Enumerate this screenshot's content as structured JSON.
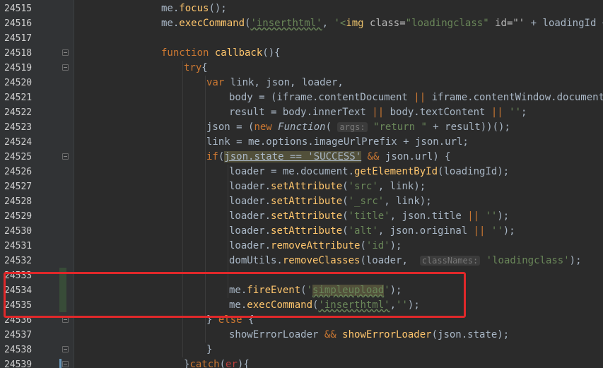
{
  "editor": {
    "lines": [
      {
        "n": "24515",
        "segs": [
          [
            "me.",
            "t"
          ],
          [
            "focus",
            "meth"
          ],
          [
            "();",
            "t"
          ]
        ],
        "indent": 228
      },
      {
        "n": "24516",
        "segs": [
          [
            "me.",
            "t"
          ],
          [
            "execCommand",
            "meth"
          ],
          [
            "(",
            "t"
          ],
          [
            "'inserthtml'",
            "str-sq"
          ],
          [
            ", ",
            "t"
          ],
          [
            "'<",
            "str"
          ],
          [
            "img",
            "tag"
          ],
          [
            " class=",
            "attr"
          ],
          [
            "\"loadingclass\"",
            "str"
          ],
          [
            " id=\"'",
            "attr"
          ],
          [
            " + loadingId + ",
            "t"
          ],
          [
            "'\"",
            "str"
          ]
        ],
        "indent": 228
      },
      {
        "n": "24517",
        "segs": [],
        "indent": 228
      },
      {
        "n": "24518",
        "segs": [
          [
            "function ",
            "kw"
          ],
          [
            "callback",
            "fn"
          ],
          [
            "(){",
            "t"
          ]
        ],
        "indent": 228
      },
      {
        "n": "24519",
        "segs": [
          [
            "try",
            "kw"
          ],
          [
            "{",
            "t"
          ]
        ],
        "indent": 260
      },
      {
        "n": "24520",
        "segs": [
          [
            "var ",
            "kw"
          ],
          [
            "link, json, loader,",
            "t"
          ]
        ],
        "indent": 292
      },
      {
        "n": "24521",
        "segs": [
          [
            "body = (iframe.contentDocument ",
            "t"
          ],
          [
            "||",
            "kw"
          ],
          [
            " iframe.contentWindow.document).b",
            "t"
          ]
        ],
        "indent": 324
      },
      {
        "n": "24522",
        "segs": [
          [
            "result = body.innerText ",
            "t"
          ],
          [
            "||",
            "kw"
          ],
          [
            " body.textContent ",
            "t"
          ],
          [
            "||",
            "kw"
          ],
          [
            " ",
            "t"
          ],
          [
            "''",
            "str"
          ],
          [
            ";",
            "t"
          ]
        ],
        "indent": 324
      },
      {
        "n": "24523",
        "segs": [
          [
            "json = (",
            "t"
          ],
          [
            "new ",
            "kw"
          ],
          [
            "Function",
            "it"
          ],
          [
            "( ",
            "t"
          ],
          [
            "args:",
            "hint"
          ],
          [
            " ",
            "t"
          ],
          [
            "\"return \"",
            "str"
          ],
          [
            " + result))();",
            "t"
          ]
        ],
        "indent": 292
      },
      {
        "n": "24524",
        "segs": [
          [
            "link = me.options.imageUrlPrefix + json.url;",
            "t"
          ]
        ],
        "indent": 292
      },
      {
        "n": "24525",
        "segs": [
          [
            "if",
            "kw"
          ],
          [
            "(",
            "t"
          ],
          [
            "json.state == 'SUCCESS'",
            "hlcond"
          ],
          [
            " ",
            "t"
          ],
          [
            "&&",
            "kw"
          ],
          [
            " json.url) {",
            "t"
          ]
        ],
        "indent": 292
      },
      {
        "n": "24526",
        "segs": [
          [
            "loader = me.document.",
            "t"
          ],
          [
            "getElementById",
            "meth"
          ],
          [
            "(loadingId);",
            "t"
          ]
        ],
        "indent": 324
      },
      {
        "n": "24527",
        "segs": [
          [
            "loader.",
            "t"
          ],
          [
            "setAttribute",
            "meth"
          ],
          [
            "(",
            "t"
          ],
          [
            "'src'",
            "str"
          ],
          [
            ", link);",
            "t"
          ]
        ],
        "indent": 324
      },
      {
        "n": "24528",
        "segs": [
          [
            "loader.",
            "t"
          ],
          [
            "setAttribute",
            "meth"
          ],
          [
            "(",
            "t"
          ],
          [
            "'_src'",
            "str"
          ],
          [
            ", link);",
            "t"
          ]
        ],
        "indent": 324
      },
      {
        "n": "24529",
        "segs": [
          [
            "loader.",
            "t"
          ],
          [
            "setAttribute",
            "meth"
          ],
          [
            "(",
            "t"
          ],
          [
            "'title'",
            "str"
          ],
          [
            ", json.title ",
            "t"
          ],
          [
            "||",
            "kw"
          ],
          [
            " ",
            "t"
          ],
          [
            "''",
            "str"
          ],
          [
            ");",
            "t"
          ]
        ],
        "indent": 324
      },
      {
        "n": "24530",
        "segs": [
          [
            "loader.",
            "t"
          ],
          [
            "setAttribute",
            "meth"
          ],
          [
            "(",
            "t"
          ],
          [
            "'alt'",
            "str"
          ],
          [
            ", json.original ",
            "t"
          ],
          [
            "||",
            "kw"
          ],
          [
            " ",
            "t"
          ],
          [
            "''",
            "str"
          ],
          [
            ");",
            "t"
          ]
        ],
        "indent": 324
      },
      {
        "n": "24531",
        "segs": [
          [
            "loader.",
            "t"
          ],
          [
            "removeAttribute",
            "meth"
          ],
          [
            "(",
            "t"
          ],
          [
            "'id'",
            "str"
          ],
          [
            ");",
            "t"
          ]
        ],
        "indent": 324
      },
      {
        "n": "24532",
        "segs": [
          [
            "domUtils.",
            "t"
          ],
          [
            "removeClasses",
            "meth"
          ],
          [
            "(loader,  ",
            "t"
          ],
          [
            "classNames:",
            "hint"
          ],
          [
            " ",
            "t"
          ],
          [
            "'loadingclass'",
            "str"
          ],
          [
            ");",
            "t"
          ]
        ],
        "indent": 324
      },
      {
        "n": "24533",
        "segs": [],
        "indent": 324
      },
      {
        "n": "24534",
        "segs": [
          [
            "me.",
            "t"
          ],
          [
            "fireEvent",
            "meth"
          ],
          [
            "(",
            "t"
          ],
          [
            "'",
            "str"
          ],
          [
            "simpleupload",
            "strhl"
          ],
          [
            "'",
            "str"
          ],
          [
            ");",
            "t"
          ]
        ],
        "indent": 324
      },
      {
        "n": "24535",
        "segs": [
          [
            "me.",
            "t"
          ],
          [
            "execCommand",
            "meth"
          ],
          [
            "(",
            "t"
          ],
          [
            "'inserthtml'",
            "str-sq"
          ],
          [
            ",",
            "t"
          ],
          [
            "''",
            "str"
          ],
          [
            ");",
            "t"
          ]
        ],
        "indent": 324
      },
      {
        "n": "24536",
        "segs": [
          [
            "} ",
            "t"
          ],
          [
            "else",
            "kw"
          ],
          [
            " {",
            "t"
          ]
        ],
        "indent": 292
      },
      {
        "n": "24537",
        "segs": [
          [
            "showErrorLoader ",
            "t"
          ],
          [
            "&&",
            "kw"
          ],
          [
            " ",
            "t"
          ],
          [
            "showErrorLoader",
            "meth"
          ],
          [
            "(json.state);",
            "t"
          ]
        ],
        "indent": 324
      },
      {
        "n": "24538",
        "segs": [
          [
            "}",
            "t"
          ]
        ],
        "indent": 292
      },
      {
        "n": "24539",
        "segs": [
          [
            "}",
            "t"
          ],
          [
            "catch",
            "kw"
          ],
          [
            "(",
            "t"
          ],
          [
            "er",
            "err"
          ],
          [
            "){",
            "t"
          ]
        ],
        "indent": 260
      }
    ],
    "fold_markers": [
      "24518",
      "24519",
      "24525",
      "24536",
      "24538",
      "24539"
    ],
    "colors": {
      "background": "#2b2b2b",
      "gutter": "#313335",
      "keyword": "#cc7832",
      "string": "#6a8759",
      "method": "#ffc66d",
      "highlight_box": "#e0282a"
    }
  }
}
